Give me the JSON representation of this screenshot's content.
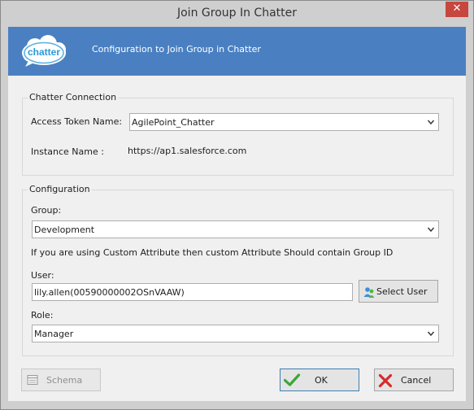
{
  "window": {
    "title": "Join Group In Chatter",
    "close_glyph": "✕"
  },
  "banner": {
    "logo_text": "chatter",
    "text": "Configuration to Join Group in Chatter"
  },
  "connection": {
    "legend": "Chatter Connection",
    "token_label": "Access Token Name:",
    "token_value": "AgilePoint_Chatter",
    "instance_label": "Instance Name :",
    "instance_value": "https://ap1.salesforce.com"
  },
  "configuration": {
    "legend": "Configuration",
    "group_label": "Group:",
    "group_value": "Development",
    "note": "If you are using Custom Attribute  then custom Attribute Should contain Group ID",
    "user_label": "User:",
    "user_value": "lily.allen(00590000002OSnVAAW)",
    "select_user_label": "Select User",
    "role_label": "Role:",
    "role_value": "Manager"
  },
  "footer": {
    "schema_label": "Schema",
    "ok_label": "OK",
    "cancel_label": "Cancel"
  },
  "colors": {
    "banner": "#4a80c2",
    "close": "#c7463e",
    "window": "#cfcfcf",
    "panel": "#f0f0f0"
  },
  "icons": {
    "logo": "chatter-cloud-logo",
    "close": "close-icon",
    "dropdown": "chevron-down-icon",
    "select_user": "users-icon",
    "schema": "schema-icon",
    "ok": "checkmark-icon",
    "cancel": "x-cancel-icon"
  }
}
